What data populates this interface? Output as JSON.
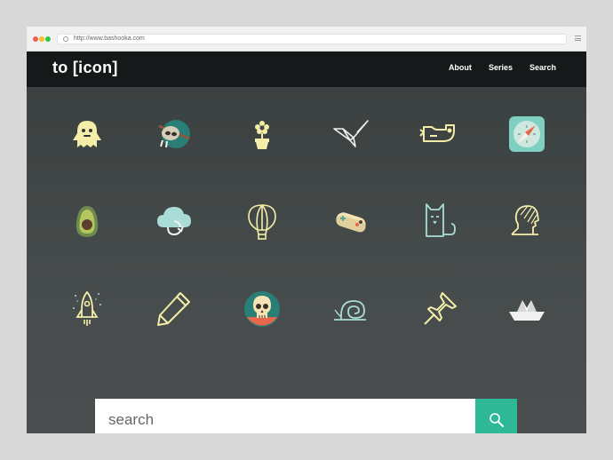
{
  "browser": {
    "url": "http://www.bashooka.com"
  },
  "header": {
    "logo": "to [icon]",
    "nav": {
      "about": "About",
      "series": "Series",
      "search": "Search"
    }
  },
  "icons": [
    "yeti-icon",
    "sloth-icon",
    "flower-pot-icon",
    "origami-bird-icon",
    "whale-icon",
    "compass-icon",
    "avocado-icon",
    "cloud-sync-icon",
    "hot-air-balloon-icon",
    "game-controller-icon",
    "cat-icon",
    "profile-head-icon",
    "rocket-icon",
    "pencil-icon",
    "skull-icon",
    "snail-icon",
    "pushpin-icon",
    "paper-boat-icon"
  ],
  "search": {
    "placeholder": "search"
  },
  "colors": {
    "accent": "#2fb896",
    "header_bg": "#161919",
    "icon_yellow": "#f4eea8",
    "icon_teal": "#7fd0c2"
  }
}
